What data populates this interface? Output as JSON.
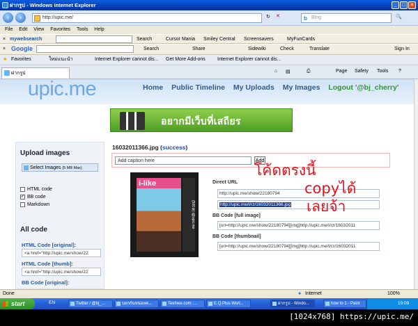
{
  "window": {
    "title": "ฝากรูป - Windows Internet Explorer"
  },
  "address": {
    "url": "http://upic.me/",
    "search_placeholder": "Bing",
    "search_engine_icon": "b"
  },
  "menu": [
    "File",
    "Edit",
    "View",
    "Favorites",
    "Tools",
    "Help"
  ],
  "toolbar1": {
    "logo": "mywebsearch",
    "search": "Search",
    "items": [
      "Cursor Mania",
      "Smiley Central",
      "Screensavers",
      "MyFunCards"
    ]
  },
  "toolbar2": {
    "logo": "Google",
    "search": "Search",
    "share": "Share",
    "sidewiki": "Sidewiki",
    "check": "Check",
    "translate": "Translate",
    "signin": "Sign In"
  },
  "favorites": {
    "label": "Favorites",
    "items": [
      "ใหม่แนะนำ",
      "Internet Explorer cannot dis...",
      "Get More Add-ons",
      "Internet Explorer cannot dis..."
    ]
  },
  "tab": {
    "label": "ฝากรูป"
  },
  "cmdbar": [
    "Page",
    "Safety",
    "Tools"
  ],
  "site": {
    "logo": "upic.me",
    "nav": [
      "Home",
      "Public Timeline",
      "My Uploads",
      "My Images"
    ],
    "logout": "Logout '@bj_cherry'",
    "banner_text": "อยากมีเว็บที่เสถียร"
  },
  "left": {
    "upload_title": "Upload images",
    "select_btn": "Select Images",
    "select_limit": "(5 MB Max)",
    "options": [
      {
        "label": "HTML code",
        "checked": false
      },
      {
        "label": "BB code",
        "checked": true
      },
      {
        "label": "Markdown",
        "checked": false
      }
    ],
    "all_code_title": "All code",
    "codes": [
      {
        "label": "HTML Code [original]:",
        "value": "<a href=\"http://upic.me/show/22"
      },
      {
        "label": "HTML Code [thumb]:",
        "value": "<a href=\"http://upic.me/show/22"
      },
      {
        "label": "BB Code [original]:",
        "value": ""
      }
    ]
  },
  "main": {
    "filename": "16032011366.jpg",
    "status": "success",
    "caption_placeholder": "Add caption here",
    "add_btn": "Add",
    "mag_title": "i-like",
    "mag_spine": "(500 ฿) i@upic.me",
    "direct_url_label": "Direct URL",
    "direct_url_1": "http://upic.me/show/22180794",
    "direct_url_2": "http://upic.me/i/rz/16032011366.jpg",
    "bb_full_label": "BB Code [full image]",
    "bb_full": "[url=http://upic.me/show/22180794][img]http://upic.me/i/rz/16032011",
    "bb_thumb_label": "BB Code [thumbnail]",
    "bb_thumb": "[url=http://upic.me/show/22180794][img]http://upic.me/t/rz/16032011"
  },
  "annotation": {
    "line1": "โค้ดตรงนี้",
    "line2": "copyได้",
    "line3": "เลยจ้า"
  },
  "status": {
    "left": "Done",
    "zone": "Internet",
    "zoom": "100%"
  },
  "taskbar": {
    "start": "start",
    "lang": "EN",
    "tasks": [
      "Twitter / @bj_...",
      "บอกกันหน่อยค...",
      "TeeNee.com :...",
      "E.Q.Plus Worl...",
      "ฝากรูป - Windo...",
      "how to 1 - Paint"
    ],
    "clock": "19:09"
  },
  "caption": "[1024x768] https://upic.me/"
}
